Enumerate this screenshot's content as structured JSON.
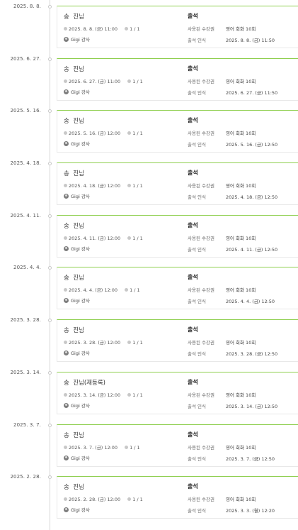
{
  "labels": {
    "ticket_key": "사용된 수강권",
    "approve_key": "출석 인식"
  },
  "colors": {
    "accent": "#8fcf4f"
  },
  "entries": [
    {
      "date": "2025. 8. 8.",
      "student": "송  진님",
      "time": "2025. 8. 8. (금) 11:00",
      "capacity": "1 / 1",
      "teacher": "Gigi 강사",
      "status": "출석",
      "ticket": "영어 회화 10회",
      "approved": "2025. 8. 8. (금) 11:50"
    },
    {
      "date": "2025. 6. 27.",
      "student": "송  진님",
      "time": "2025. 6. 27. (금) 11:00",
      "capacity": "1 / 1",
      "teacher": "Gigi 강사",
      "status": "출석",
      "ticket": "영어 회화 10회",
      "approved": "2025. 6. 27. (금) 11:50"
    },
    {
      "date": "2025. 5. 16.",
      "student": "송  진님",
      "time": "2025. 5. 16. (금) 12:00",
      "capacity": "1 / 1",
      "teacher": "Gigi 강사",
      "status": "출석",
      "ticket": "영어 회화 10회",
      "approved": "2025. 5. 16. (금) 12:50"
    },
    {
      "date": "2025. 4. 18.",
      "student": "송  진님",
      "time": "2025. 4. 18. (금) 12:00",
      "capacity": "1 / 1",
      "teacher": "Gigi 강사",
      "status": "출석",
      "ticket": "영어 회화 10회",
      "approved": "2025. 4. 18. (금) 12:50"
    },
    {
      "date": "2025. 4. 11.",
      "student": "송  진님",
      "time": "2025. 4. 11. (금) 12:00",
      "capacity": "1 / 1",
      "teacher": "Gigi 강사",
      "status": "출석",
      "ticket": "영어 회화 10회",
      "approved": "2025. 4. 11. (금) 12:50"
    },
    {
      "date": "2025. 4. 4.",
      "student": "송  진님",
      "time": "2025. 4. 4. (금) 12:00",
      "capacity": "1 / 1",
      "teacher": "Gigi 강사",
      "status": "출석",
      "ticket": "영어 회화 10회",
      "approved": "2025. 4. 4. (금) 12:50"
    },
    {
      "date": "2025. 3. 28.",
      "student": "송  진님",
      "time": "2025. 3. 28. (금) 12:00",
      "capacity": "1 / 1",
      "teacher": "Gigi 강사",
      "status": "출석",
      "ticket": "영어 회화 10회",
      "approved": "2025. 3. 28. (금) 12:50"
    },
    {
      "date": "2025. 3. 14.",
      "student": "송  진님(재등록)",
      "time": "2025. 3. 14. (금) 12:00",
      "capacity": "1 / 1",
      "teacher": "Gigi 강사",
      "status": "출석",
      "ticket": "영어 회화 10회",
      "approved": "2025. 3. 14. (금) 12:50"
    },
    {
      "date": "2025. 3. 7.",
      "student": "송  진님",
      "time": "2025. 3. 7. (금) 12:00",
      "capacity": "1 / 1",
      "teacher": "Gigi 강사",
      "status": "출석",
      "ticket": "영어 회화 10회",
      "approved": "2025. 3. 7. (금) 12:50"
    },
    {
      "date": "2025. 2. 28.",
      "student": "송  진님",
      "time": "2025. 2. 28. (금) 12:00",
      "capacity": "1 / 1",
      "teacher": "Gigi 강사",
      "status": "출석",
      "ticket": "영어 회화 10회",
      "approved": "2025. 3. 3. (월) 12:20"
    }
  ]
}
